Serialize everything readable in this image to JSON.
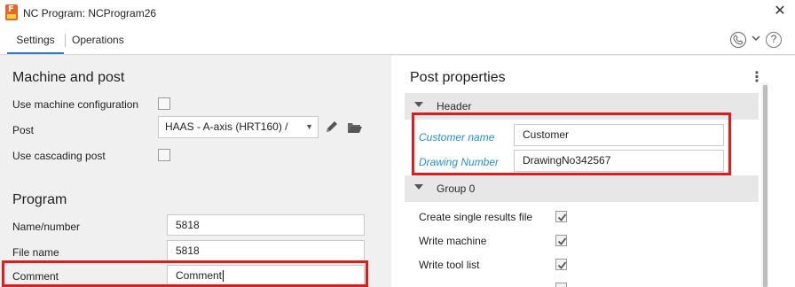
{
  "window": {
    "title": "NC Program: NCProgram26",
    "close_symbol": "✕"
  },
  "tabs": [
    {
      "label": "Settings",
      "active": true
    },
    {
      "label": "Operations",
      "active": false
    }
  ],
  "left": {
    "machine_section": {
      "title": "Machine and post",
      "use_machine_configuration_label": "Use machine configuration",
      "post_label": "Post",
      "post_value": "HAAS - A-axis (HRT160) /",
      "use_cascading_post_label": "Use cascading post"
    },
    "program_section": {
      "title": "Program",
      "name_label": "Name/number",
      "name_value": "5818",
      "file_label": "File name",
      "file_value": "5818",
      "comment_label": "Comment",
      "comment_value": "Comment"
    }
  },
  "right": {
    "title": "Post properties",
    "kebab": "⋮",
    "groups": [
      {
        "label": "Header"
      },
      {
        "label": "Group 0"
      }
    ],
    "header_props": {
      "customer_label": "Customer name",
      "customer_value": "Customer",
      "drawing_label": "Drawing Number",
      "drawing_value": "DrawingNo342567"
    },
    "group0_props": [
      {
        "label": "Create single results file",
        "checked": true
      },
      {
        "label": "Write machine",
        "checked": true
      },
      {
        "label": "Write tool list",
        "checked": true
      }
    ]
  },
  "colors": {
    "accent": "#2a7fd4",
    "highlight": "#e01b1b",
    "link": "#2a8fd0"
  },
  "icons": [
    "app-icon",
    "close-icon",
    "phone-icon",
    "chevron-down-icon",
    "help-icon",
    "pen-icon",
    "folder-icon",
    "kebab-menu-icon",
    "collapse-triangle-icon",
    "checkmark-icon"
  ]
}
